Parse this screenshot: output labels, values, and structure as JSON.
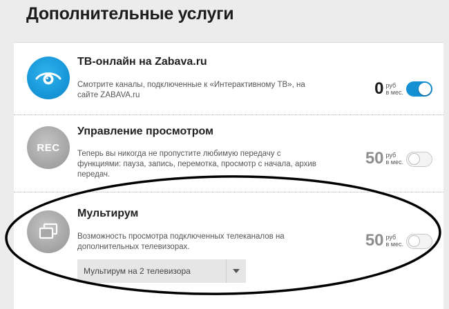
{
  "page_title": "Дополнительные услуги",
  "services": [
    {
      "title": "ТВ-онлайн на Zabava.ru",
      "description": "Смотрите каналы, подключенные к «Интерактивному ТВ», на сайте ZABAVA.ru",
      "price": "0",
      "price_unit_1": "руб",
      "price_unit_2": "в мес.",
      "enabled": true,
      "icon": "eye-icon"
    },
    {
      "title": "Управление просмотром",
      "description": "Теперь вы никогда не пропустите любимую передачу с функциями: пауза, запись, перемотка, просмотр с начала, архив передач.",
      "price": "50",
      "price_unit_1": "руб",
      "price_unit_2": "в мес.",
      "enabled": false,
      "icon_text": "REC"
    },
    {
      "title": "Мультирум",
      "description": "Возможность просмотра подключенных телеканалов на дополнительных телевизорах.",
      "price": "50",
      "price_unit_1": "руб",
      "price_unit_2": "в мес.",
      "enabled": false,
      "icon": "windows-icon",
      "select_value": "Мультирум на 2 телевизора"
    }
  ],
  "colors": {
    "accent": "#1590d3",
    "background": "#ececec",
    "card": "#ffffff"
  }
}
